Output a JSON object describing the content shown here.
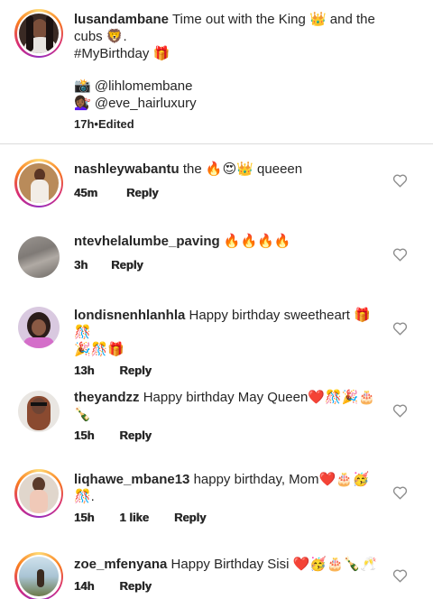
{
  "caption": {
    "username": "lusandambane",
    "text_line1": "Time out with the King 👑 and the",
    "text_line2": "cubs 🦁.",
    "hashtag": "#MyBirthday 🎁",
    "credit1": "📸 @lihlomembane",
    "credit2": "💇🏾‍♀️ @eve_hairluxury",
    "time": "17h",
    "separator": "•",
    "edited": "Edited"
  },
  "comments": [
    {
      "username": "nashleywabantu",
      "text": "the 🔥😍👑 queeen",
      "text2": "",
      "time": "45m",
      "likes": "",
      "reply": "Reply"
    },
    {
      "username": "ntevhelalumbe_paving",
      "text": "🔥🔥🔥🔥",
      "text2": "",
      "time": "3h",
      "likes": "",
      "reply": "Reply"
    },
    {
      "username": "londisnenhlanhla",
      "text": "Happy birthday sweetheart 🎁🎊",
      "text2": "🎉🎊🎁",
      "time": "13h",
      "likes": "",
      "reply": "Reply"
    },
    {
      "username": "theyandzz",
      "text": "Happy birthday May Queen❤️🎊🎉🎂",
      "text2": "🍾",
      "time": "15h",
      "likes": "",
      "reply": "Reply"
    },
    {
      "username": "liqhawe_mbane13",
      "text": "happy birthday, Mom❤️🎂🥳",
      "text2": "🎊.",
      "time": "15h",
      "likes": "1 like",
      "reply": "Reply"
    },
    {
      "username": "zoe_mfenyana",
      "text": "Happy Birthday Sisi ❤️🥳🎂🍾🥂",
      "text2": "",
      "time": "14h",
      "likes": "",
      "reply": "Reply"
    }
  ],
  "colors": {
    "text": "#262626",
    "divider": "#dbdbdb",
    "heart": "#8e8e8e"
  },
  "icons": {
    "like": "heart-outline-icon"
  }
}
